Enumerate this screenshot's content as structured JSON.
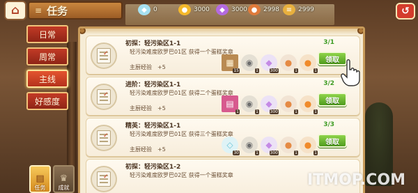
{
  "topbar": {
    "title": "任务",
    "currencies": [
      {
        "icon": "diamond-icon",
        "value": "0",
        "color": "#a6e0f0"
      },
      {
        "icon": "gold-coin-icon",
        "value": "3000",
        "color": "#f5b82a"
      },
      {
        "icon": "purple-gem-icon",
        "value": "3000",
        "color": "#b46ae0"
      },
      {
        "icon": "food-icon",
        "value": "2998",
        "color": "#e07a3a"
      },
      {
        "icon": "coin-stack-icon",
        "value": "2999",
        "color": "#e8b03e"
      }
    ]
  },
  "side_tabs": [
    {
      "label": "日常",
      "active": false
    },
    {
      "label": "周常",
      "active": false
    },
    {
      "label": "主线",
      "active": true
    },
    {
      "label": "好感度",
      "active": false
    }
  ],
  "bottom_nav": [
    {
      "label": "任务",
      "active": true
    },
    {
      "label": "成就",
      "active": false
    }
  ],
  "quests": [
    {
      "title": "初探：轻污染区1-1",
      "desc": "轻污染难度欧罗巴01区 获得一个蛋糕奖章",
      "exp_label": "主厨经验",
      "exp_value": "+5",
      "progress": "3/1",
      "claim": "领取",
      "rewards": [
        {
          "icon": "crate-icon",
          "count": "15",
          "color": "#b98a52",
          "glyph": "▦"
        },
        {
          "icon": "pan-icon",
          "count": "1",
          "color": "#8c8c8c",
          "glyph": "◉"
        },
        {
          "icon": "purple-gem-icon",
          "count": "300",
          "color": "#c48ae6",
          "glyph": "◆"
        },
        {
          "icon": "food-icon",
          "count": "1",
          "color": "#e58a44",
          "glyph": "●"
        },
        {
          "icon": "orange-food-icon",
          "count": "1",
          "color": "#f08a2a",
          "glyph": "●"
        }
      ]
    },
    {
      "title": "进阶：轻污染区1-1",
      "desc": "轻污染难度欧罗巴01区 获得二个蛋糕奖章",
      "exp_label": "主厨经验",
      "exp_value": "+5",
      "progress": "3/2",
      "claim": "领取",
      "rewards": [
        {
          "icon": "card-icon",
          "count": "1",
          "color": "#d75a8e",
          "glyph": "▤"
        },
        {
          "icon": "pan-icon",
          "count": "1",
          "color": "#8c8c8c",
          "glyph": "◉"
        },
        {
          "icon": "purple-gem-icon",
          "count": "300",
          "color": "#c48ae6",
          "glyph": "◆"
        },
        {
          "icon": "food-icon",
          "count": "1",
          "color": "#e58a44",
          "glyph": "●"
        },
        {
          "icon": "orange-food-icon",
          "count": "1",
          "color": "#f08a2a",
          "glyph": "●"
        }
      ]
    },
    {
      "title": "精英：轻污染区1-1",
      "desc": "轻污染难度欧罗巴01区 获得三个蛋糕奖章",
      "exp_label": "主厨经验",
      "exp_value": "+5",
      "progress": "3/3",
      "claim": "领取",
      "rewards": [
        {
          "icon": "diamond-icon",
          "count": "30",
          "color": "#b8e8f0",
          "glyph": "◇"
        },
        {
          "icon": "pan-icon",
          "count": "1",
          "color": "#8c8c8c",
          "glyph": "◉"
        },
        {
          "icon": "purple-gem-icon",
          "count": "300",
          "color": "#c48ae6",
          "glyph": "◆"
        },
        {
          "icon": "food-icon",
          "count": "1",
          "color": "#e58a44",
          "glyph": "●"
        },
        {
          "icon": "orange-food-icon",
          "count": "1",
          "color": "#f08a2a",
          "glyph": "●"
        }
      ]
    },
    {
      "title": "初探：轻污染区1-2",
      "desc": "轻污染难度欧罗巴02区 获得一个蛋糕奖章",
      "exp_label": "",
      "exp_value": "",
      "progress": "",
      "claim": "",
      "rewards": []
    }
  ],
  "watermark": "ITMOP.COM"
}
